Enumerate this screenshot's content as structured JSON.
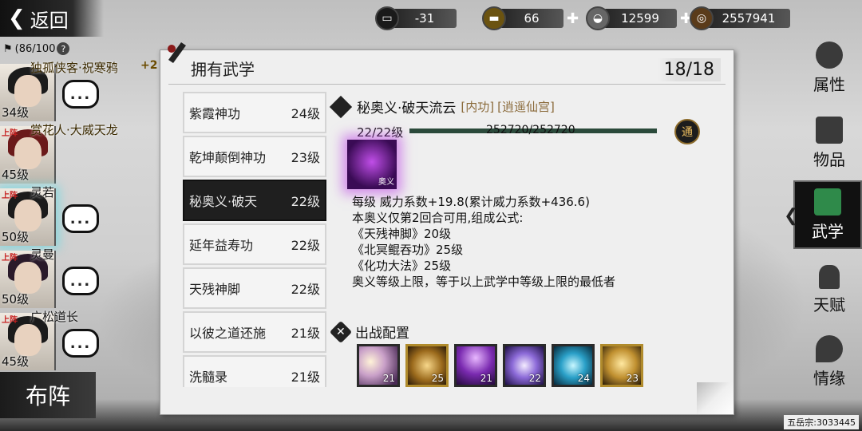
{
  "header": {
    "back_label": "返回",
    "resources": [
      {
        "name": "bed-icon",
        "value": "-31",
        "has_plus": false
      },
      {
        "name": "gold-bar-icon",
        "value": "66",
        "has_plus": true
      },
      {
        "name": "silver-ingot-icon",
        "value": "12599",
        "has_plus": true
      },
      {
        "name": "coin-icon",
        "value": "2557941",
        "has_plus": false
      }
    ]
  },
  "party": {
    "capacity": "(86/100",
    "help": "?",
    "members": [
      {
        "tag": "",
        "name": "独孤侠客·祝寒鸦",
        "level": "34级",
        "bonus": "+2"
      },
      {
        "tag": "上阵",
        "name": "赏花人·大威天龙",
        "level": "45级",
        "bonus": ""
      },
      {
        "tag": "上阵",
        "name": "灵若",
        "level": "50级",
        "bonus": ""
      },
      {
        "tag": "上阵",
        "name": "灵曼",
        "level": "50级",
        "bonus": ""
      },
      {
        "tag": "上阵",
        "name": "广松道长",
        "level": "45级",
        "bonus": ""
      }
    ],
    "chat_label": "...",
    "formation_label": "布阵"
  },
  "panel": {
    "title": "拥有武学",
    "count": "18/18",
    "skills": [
      {
        "name": "紫霞神功",
        "level": "24级"
      },
      {
        "name": "乾坤颠倒神功",
        "level": "23级"
      },
      {
        "name": "秘奥义·破天",
        "level": "22级"
      },
      {
        "name": "延年益寿功",
        "level": "22级"
      },
      {
        "name": "天残神脚",
        "level": "22级"
      },
      {
        "name": "以彼之道还施",
        "level": "21级"
      },
      {
        "name": "洗髓录",
        "level": "21级"
      }
    ],
    "detail": {
      "name": "秘奥义·破天流云",
      "type": "[内功]",
      "sect": "[逍遥仙宫]",
      "level": "22/22级",
      "xp": "252720/252720",
      "xp_progress": 1.0,
      "breakthrough_label": "通",
      "icon_badge": "奥义",
      "lines": [
        "每级   威力系数+19.8(累计威力系数+436.6)",
        "本奥义仅第2回合可用,组成公式:",
        "《天残神脚》20级",
        "《北冥鲲吞功》25级",
        "《化功大法》25级",
        "奥义等级上限，等于以上武学中等级上限的最低者"
      ],
      "deploy_title": "出战配置",
      "deploy_slots": [
        "21",
        "25",
        "21",
        "22",
        "24",
        "23"
      ]
    }
  },
  "tabs": [
    {
      "label": "属性"
    },
    {
      "label": "物品"
    },
    {
      "label": "武学"
    },
    {
      "label": "天赋"
    },
    {
      "label": "情缘"
    }
  ],
  "footer": {
    "sect_id": "五岳宗:3033445"
  }
}
